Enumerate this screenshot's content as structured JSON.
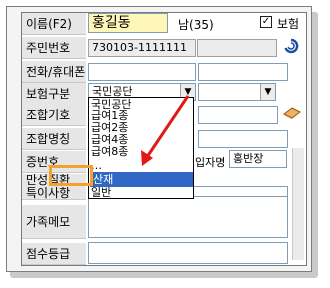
{
  "form": {
    "name_label": "이름(F2)",
    "name_value": "홍길동",
    "gender_age": "남(35)",
    "insurance_checkbox_checked": true,
    "insurance_label": "보험",
    "resident_no_label": "주민번호",
    "resident_no_value": "730103-1111111",
    "phone_label": "전화/휴대폰",
    "insurance_type_label": "보험구분",
    "insurance_type_value": "국민공단",
    "combo_arrow": "▼",
    "assoc_code_label": "조합기호",
    "assoc_name_label": "조합명칭",
    "cert_no_label": "증번호",
    "chronic_label": "만성질환",
    "special_label": "특이사항",
    "family_memo_label": "가족메모",
    "score_label": "점수등급",
    "insured_partial": "입자명",
    "insured_value": "홍반장"
  },
  "dropdown": {
    "items": [
      "국민공단",
      "급여1종",
      "급여2종",
      "급여4종",
      "급여8종",
      "…",
      "산재",
      "일반"
    ],
    "selected": "산재"
  },
  "colors": {
    "name_highlight": "#fff7b8",
    "selection": "#3168c6",
    "callout_box": "#f5a22c",
    "arrow": "#e01818"
  }
}
